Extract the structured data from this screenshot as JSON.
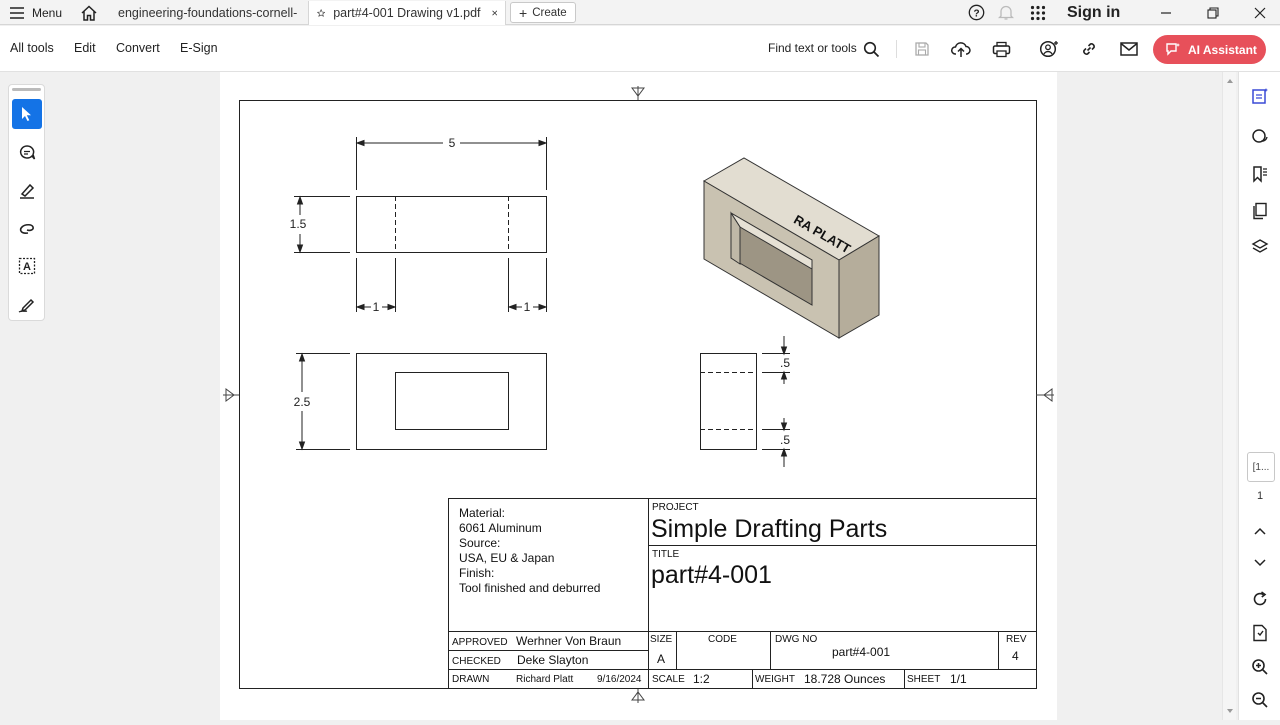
{
  "titlebar": {
    "menu_label": "Menu",
    "tabs": [
      {
        "label": "engineering-foundations-cornell-..."
      },
      {
        "label": "part#4-001 Drawing v1.pdf"
      }
    ],
    "create_label": "Create",
    "sign_in": "Sign in"
  },
  "toolbar": {
    "menu": [
      "All tools",
      "Edit",
      "Convert",
      "E-Sign"
    ],
    "find_label": "Find text or tools",
    "ai_assistant": "AI Assistant"
  },
  "drawing": {
    "dims": {
      "top_width": "5",
      "top_height": "1.5",
      "left_offset": "1",
      "right_offset": "1",
      "front_height": "2.5",
      "side_top": ".5",
      "side_bottom": ".5"
    },
    "logo_text": "RA PLATT",
    "title_block": {
      "material_label": "Material:",
      "material_value": "6061 Aluminum",
      "source_label": "Source:",
      "source_value": "USA, EU & Japan",
      "finish_label": "Finish:",
      "finish_value": "Tool finished and deburred",
      "project_label": "PROJECT",
      "project_value": "Simple Drafting Parts",
      "title_label": "TITLE",
      "title_value": "part#4-001",
      "approved_label": "APPROVED",
      "approved_value": "Werhner Von Braun",
      "checked_label": "CHECKED",
      "checked_value": "Deke Slayton",
      "drawn_label": "DRAWN",
      "drawn_value": "Richard Platt",
      "drawn_date": "9/16/2024",
      "size_label": "SIZE",
      "size_value": "A",
      "code_label": "CODE",
      "dwg_label": "DWG NO",
      "dwg_value": "part#4-001",
      "rev_label": "REV",
      "rev_value": "4",
      "scale_label": "SCALE",
      "scale_value": "1:2",
      "weight_label": "WEIGHT",
      "weight_value": "18.728 Ounces",
      "sheet_label": "SHEET",
      "sheet_value": "1/1"
    }
  },
  "right_rail": {
    "page_box": "[1...",
    "page_number": "1"
  }
}
